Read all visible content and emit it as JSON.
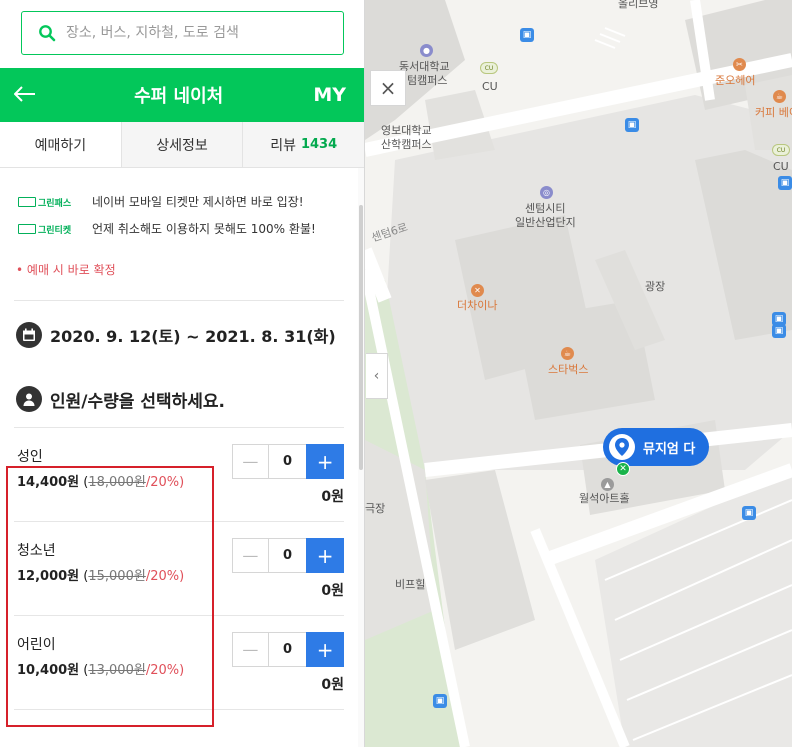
{
  "search": {
    "placeholder": "장소, 버스, 지하철, 도로 검색"
  },
  "header": {
    "back_icon": "arrow-left-icon",
    "title": "수퍼 네이처",
    "my_label": "MY"
  },
  "tabs": [
    {
      "label": "예매하기",
      "active": true
    },
    {
      "label": "상세정보"
    },
    {
      "label": "리뷰",
      "count": "1434"
    }
  ],
  "notices": [
    {
      "badge": "그린패스",
      "text": "네이버 모바일 티켓만 제시하면 바로 입장!"
    },
    {
      "badge": "그린티켓",
      "text": "언제 취소해도 이용하지 못해도 100% 환불!"
    }
  ],
  "confirm_text": "예매 시 바로 확정",
  "date_range": "2020. 9. 12(토) ~ 2021. 8. 31(화)",
  "people_prompt": "인원/수량을 선택하세요.",
  "tickets": [
    {
      "name": "성인",
      "price": "14,400원",
      "original": "18,000원",
      "discount": "/20%)",
      "open": " (",
      "quantity": "0",
      "total": "0원"
    },
    {
      "name": "청소년",
      "price": "12,000원",
      "original": "15,000원",
      "discount": "/20%)",
      "open": " (",
      "quantity": "0",
      "total": "0원"
    },
    {
      "name": "어린이",
      "price": "10,400원",
      "original": "13,000원",
      "discount": "/20%)",
      "open": " (",
      "quantity": "0",
      "total": "0원"
    }
  ],
  "map": {
    "close_label": "×",
    "collapse_label": "‹",
    "pin_label": "뮤지엄 다",
    "labels": {
      "l1": "올리브영",
      "l2": "동서대학교",
      "l3": "텀캠퍼스",
      "l4": "CU",
      "l5": "준오헤어",
      "l6": "커피 베이",
      "l7": "영보대학교",
      "l8": "산학캠퍼스",
      "l9": "센텀시티",
      "l10": "일반산업단지",
      "l11": "센텀6로",
      "l12": "CU",
      "l13": "더차이나",
      "l14": "광장",
      "l15": "스타벅스",
      "l16": "월석아트홀",
      "l17": "극장",
      "l18": "비프힐"
    }
  },
  "colors": {
    "brand": "#03c75a",
    "accent_blue": "#2e7be6",
    "discount_red": "#e0505a",
    "highlight": "#d6202a"
  }
}
